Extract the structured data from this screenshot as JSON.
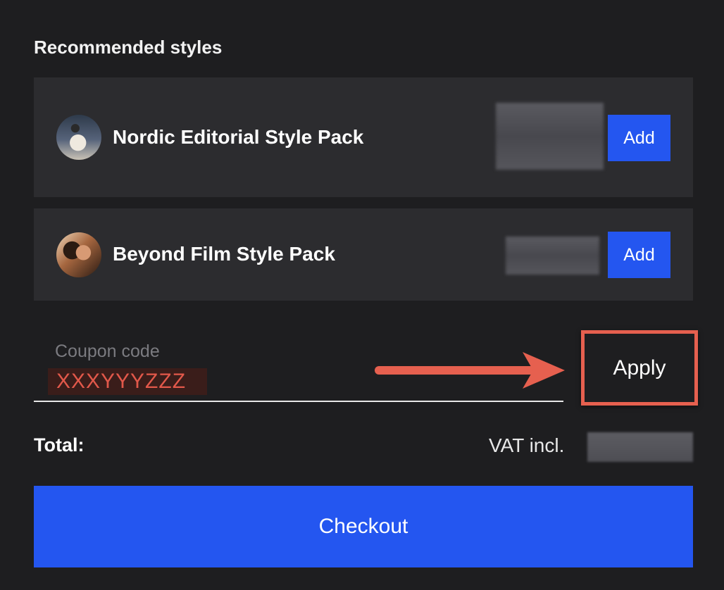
{
  "section_title": "Recommended styles",
  "recommendations": [
    {
      "title": "Nordic Editorial Style Pack",
      "add_label": "Add"
    },
    {
      "title": "Beyond Film Style Pack",
      "add_label": "Add"
    }
  ],
  "coupon": {
    "label": "Coupon code",
    "value": "XXXYYYZZZ",
    "apply_label": "Apply"
  },
  "total": {
    "label": "Total:",
    "vat_label": "VAT incl."
  },
  "checkout_label": "Checkout",
  "colors": {
    "accent_blue": "#2456f0",
    "highlight_red": "#e6604f",
    "background": "#1e1e20",
    "card": "#2c2c2f"
  },
  "icons": {
    "pack_1_thumbnail": "avatar-image",
    "pack_2_thumbnail": "avatar-image",
    "annotation": "arrow-right-icon"
  }
}
